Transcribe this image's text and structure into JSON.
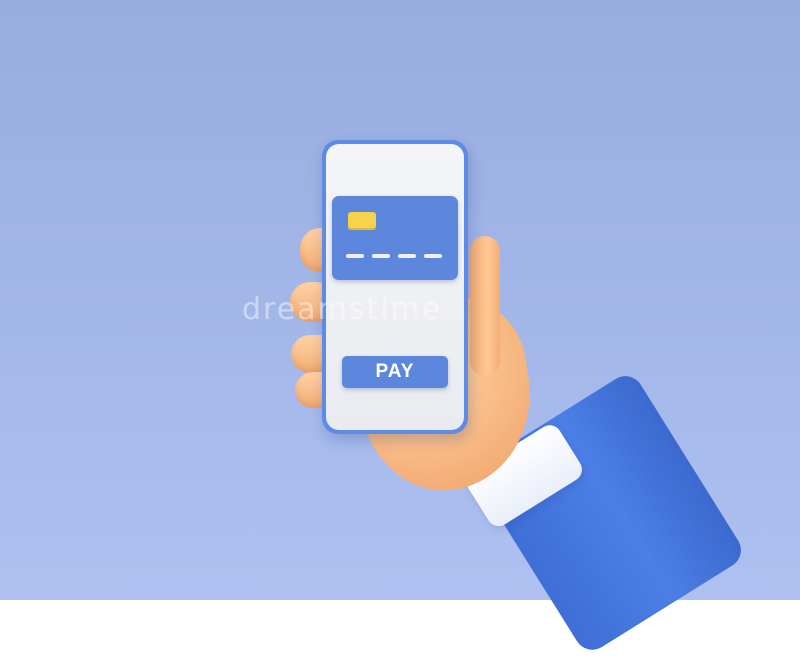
{
  "pay_button": {
    "label": "PAY"
  },
  "watermark": {
    "text": "dreamstime"
  },
  "colors": {
    "background": "#a4b8ea",
    "phone_frame": "#5e8be6",
    "card": "#5d86dd",
    "chip": "#f7d34b",
    "sleeve": "#4c7fe6",
    "skin": "#f7b983"
  },
  "icons": [
    "credit-card-icon",
    "card-chip-icon"
  ]
}
